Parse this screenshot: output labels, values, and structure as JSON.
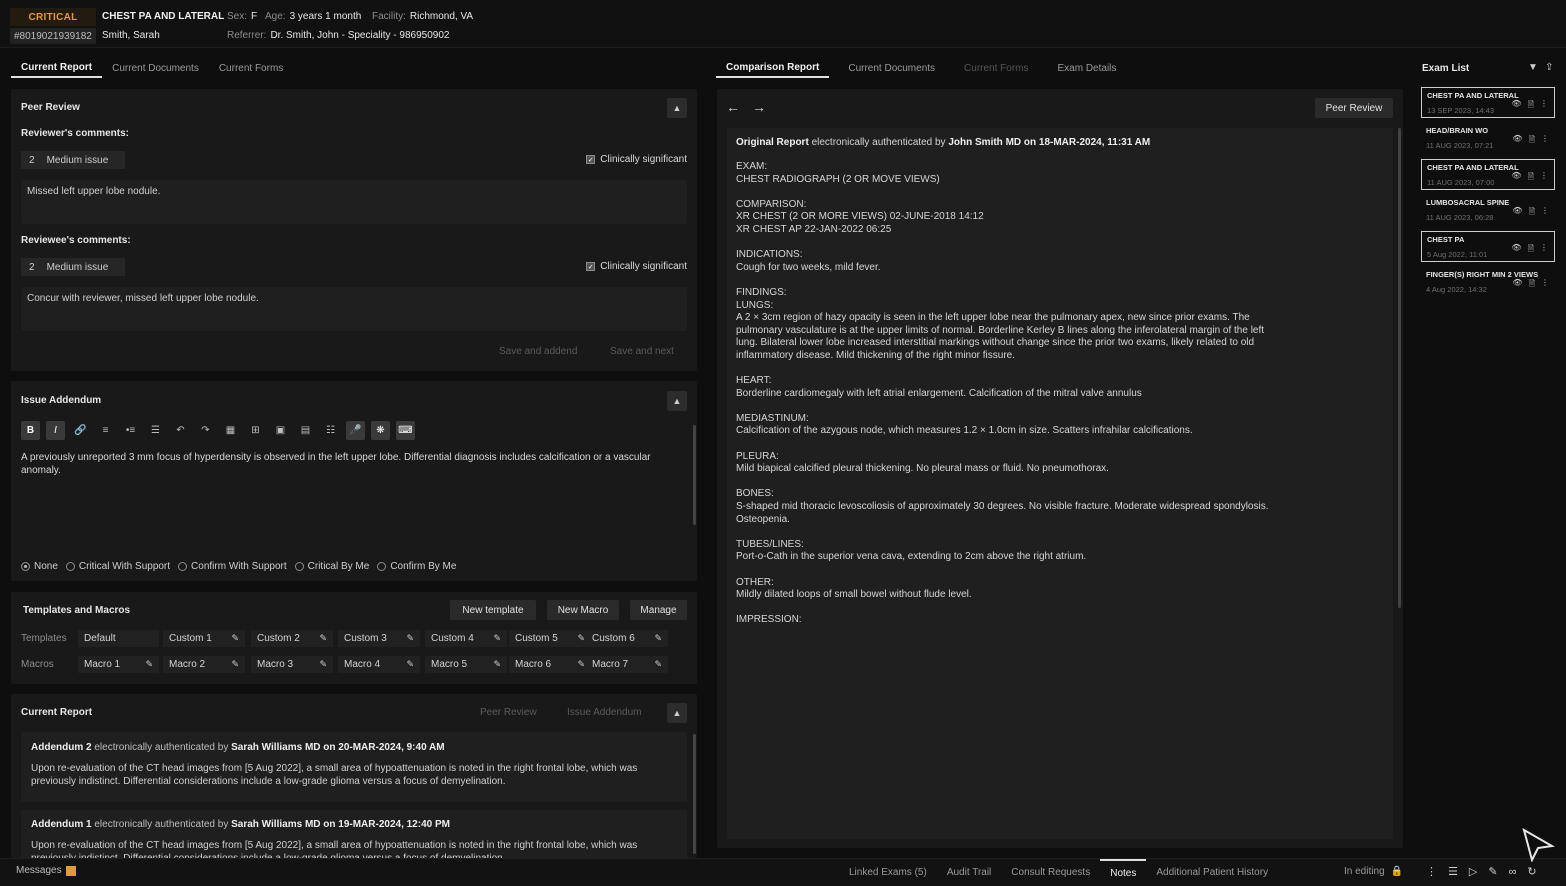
{
  "header": {
    "critical_label": "CRITICAL",
    "exam_title": "CHEST PA AND LATERAL",
    "sex_label": "Sex:",
    "sex_value": "F",
    "age_label": "Age:",
    "age_value": "3 years 1 month",
    "facility_label": "Facility:",
    "facility_value": "Richmond, VA",
    "accession": "#8019021939182",
    "patient_name": "Smith, Sarah",
    "referrer_label": "Referrer:",
    "referrer_value": "Dr. Smith, John - Speciality - 986950902",
    "critical_color": "#e39a3b"
  },
  "left_tabs": [
    "Current Report",
    "Current Documents",
    "Current Forms"
  ],
  "middle_tabs": [
    "Comparison Report",
    "Current Documents",
    "Current Forms",
    "Exam Details"
  ],
  "peer_review": {
    "title": "Peer Review",
    "reviewer_heading": "Reviewer's comments:",
    "reviewer_sev_num": "2",
    "reviewer_sev_text": "Medium issue",
    "reviewer_clin": "Clinically significant",
    "reviewer_comment": "Missed left upper lobe nodule.",
    "reviewee_heading": "Reviewee's comments:",
    "reviewee_sev_num": "2",
    "reviewee_sev_text": "Medium issue",
    "reviewee_clin": "Clinically significant",
    "reviewee_comment": "Concur with reviewer, missed left upper lobe nodule.",
    "save_addend": "Save and addend",
    "save_next": "Save and next"
  },
  "addendum": {
    "title": "Issue Addendum",
    "text": "A previously unreported 3 mm focus of hyperdensity is observed in the left upper lobe. Differential diagnosis includes calcification or a vascular anomaly.",
    "options": [
      "None",
      "Critical With Support",
      "Confirm With Support",
      "Critical By Me",
      "Confirm By Me"
    ]
  },
  "templates": {
    "title": "Templates and Macros",
    "new_template": "New template",
    "new_macro": "New Macro",
    "manage": "Manage",
    "templates_label": "Templates",
    "macros_label": "Macros",
    "template_items": [
      "Default",
      "Custom 1",
      "Custom 2",
      "Custom 3",
      "Custom 4",
      "Custom 5",
      "Custom 6"
    ],
    "macro_items": [
      "Macro 1",
      "Macro 2",
      "Macro 3",
      "Macro 4",
      "Macro 5",
      "Macro 6",
      "Macro 7"
    ]
  },
  "current_report": {
    "title": "Current Report",
    "peer_review": "Peer Review",
    "issue_addendum": "Issue Addendum",
    "add2_label": "Addendum 2",
    "add2_auth": "electronically authenticated by",
    "add2_by": "Sarah Williams MD on 20-MAR-2024, 9:40 AM",
    "add2_text": "Upon re-evaluation of the CT head images from [5 Aug 2022], a small area of hypoattenuation is noted in the right frontal lobe, which was previously indistinct. Differential considerations include a low-grade glioma versus a focus of demyelination.",
    "add1_label": "Addendum 1",
    "add1_auth": "electronically authenticated by",
    "add1_by": "Sarah Williams MD on 19-MAR-2024, 12:40 PM",
    "add1_text": "Upon re-evaluation of the CT head images from [5 Aug 2022], a small area of hypoattenuation is noted in the right frontal lobe, which was previously indistinct. Differential considerations include a low-grade glioma versus a focus of demyelination."
  },
  "comparison": {
    "peer_review_btn": "Peer Review",
    "orig_label": "Original Report",
    "orig_auth": "electronically authenticated by",
    "orig_by": "John Smith MD on 18-MAR-2024, 11:31 AM",
    "lines": [
      "EXAM:",
      "CHEST RADIOGRAPH (2 OR MOVE VIEWS)",
      "",
      "COMPARISON:",
      "XR CHEST (2 OR MORE VIEWS)  02-JUNE-2018 14:12",
      "XR CHEST AP 22-JAN-2022 06:25",
      "",
      "INDICATIONS:",
      "Cough for two weeks, mild fever.",
      "",
      "FINDINGS:",
      "LUNGS:",
      "A 2 × 3cm region of hazy opacity is seen in the left upper lobe near the pulmonary apex, new since prior exams.  The",
      "pulmonary vasculature is at the upper limits of normal. Borderline Kerley B lines along the inferolateral margin of the left",
      "lung. Bilateral lower lobe increased interstitial markings without change since the prior two exams, likely related to old",
      "inflammatory disease. Mild thickening of the right minor fissure.",
      "",
      "HEART:",
      "Borderline cardiomegaly with left atrial enlargement. Calcification of the mitral valve annulus",
      "",
      "MEDIASTINUM:",
      "Calcification of the azygous node, which measures 1.2 × 1.0cm in size. Scatters infrahilar calcifications.",
      "",
      "PLEURA:",
      "Mild biapical calcified pleural thickening.  No pleural mass or fluid.  No pneumothorax.",
      "",
      "BONES:",
      "S-shaped mid thoracic levoscoliosis of approximately 30 degrees. No visible fracture. Moderate widespread spondylosis.",
      "Osteopenia.",
      "",
      "TUBES/LINES:",
      "Port-o-Cath in the superior vena cava, extending to 2cm above the right atrium.",
      "",
      "OTHER:",
      "Mildly dilated loops of small bowel without flude level.",
      "",
      "IMPRESSION:"
    ]
  },
  "exam_list": {
    "title": "Exam List",
    "items": [
      {
        "name": "CHEST PA AND LATERAL",
        "date": "13 SEP 2023, 14:43",
        "boxed": true
      },
      {
        "name": "HEAD/BRAIN WO",
        "date": "11 AUG 2023, 07:21",
        "boxed": false
      },
      {
        "name": "CHEST PA AND LATERAL",
        "date": "11 AUG 2023, 07:00",
        "boxed": true
      },
      {
        "name": "LUMBOSACRAL SPINE",
        "date": "11 AUG 2023, 06:28",
        "boxed": false
      },
      {
        "name": "CHEST PA",
        "date": "5 Aug 2022, 11:01",
        "boxed": true
      },
      {
        "name": "FINGER(S) RIGHT MIN 2 VIEWS",
        "date": "4 Aug 2022, 14:32",
        "boxed": false
      }
    ]
  },
  "footer": {
    "messages": "Messages",
    "tabs": [
      "Linked Exams (5)",
      "Audit Trail",
      "Consult Requests",
      "Notes",
      "Additional Patient History"
    ],
    "active_tab": "Notes",
    "in_editing": "In editing"
  }
}
